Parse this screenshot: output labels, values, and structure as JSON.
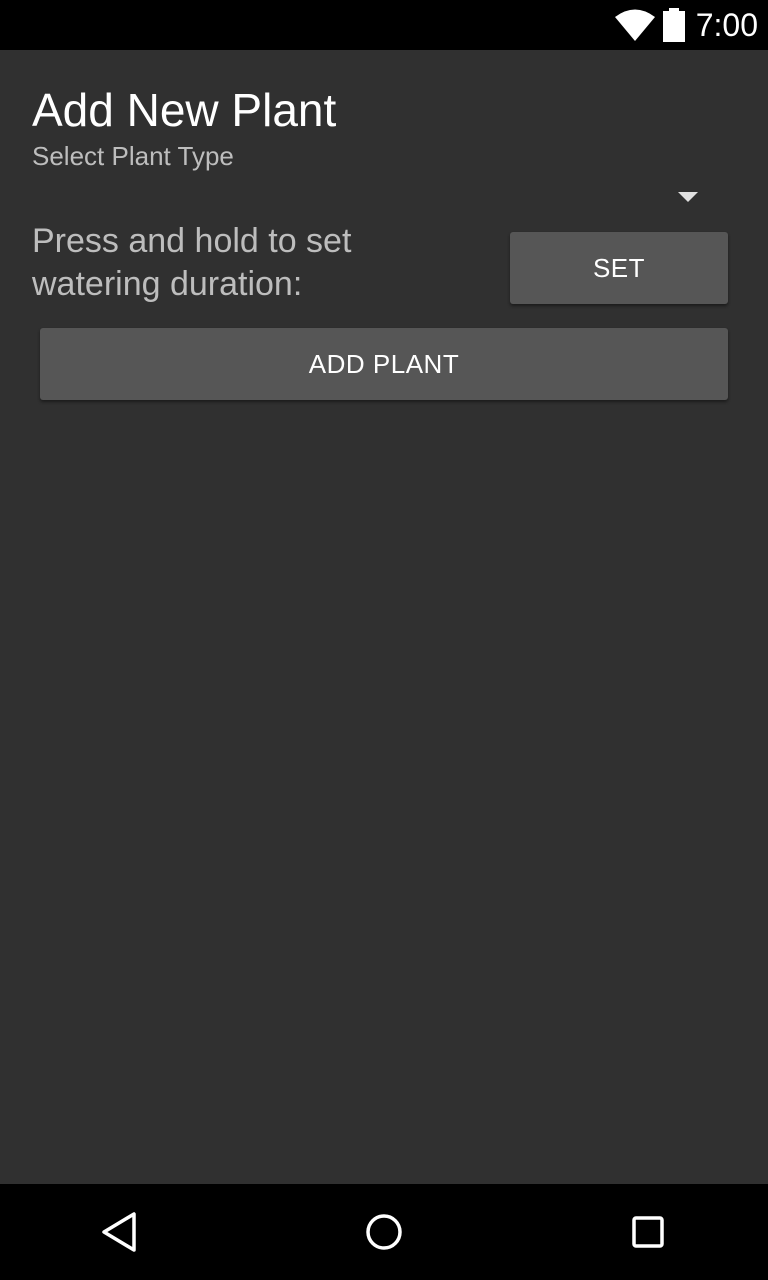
{
  "status_bar": {
    "time": "7:00",
    "icons": [
      "wifi-icon",
      "battery-icon"
    ]
  },
  "screen": {
    "title": "Add New Plant",
    "subtitle": "Select Plant Type"
  },
  "plant_type_spinner": {
    "selected_value": "",
    "icon": "dropdown-arrow-icon"
  },
  "watering": {
    "label": "Press and hold to set watering duration:",
    "set_button_label": "SET"
  },
  "actions": {
    "add_plant_label": "ADD PLANT"
  },
  "nav_bar": {
    "icons": [
      "back-icon",
      "home-icon",
      "recents-icon"
    ]
  },
  "colors": {
    "background": "#303030",
    "bars": "#000000",
    "button": "#565656",
    "title_text": "#ffffff",
    "secondary_text": "#bdbdbd"
  }
}
